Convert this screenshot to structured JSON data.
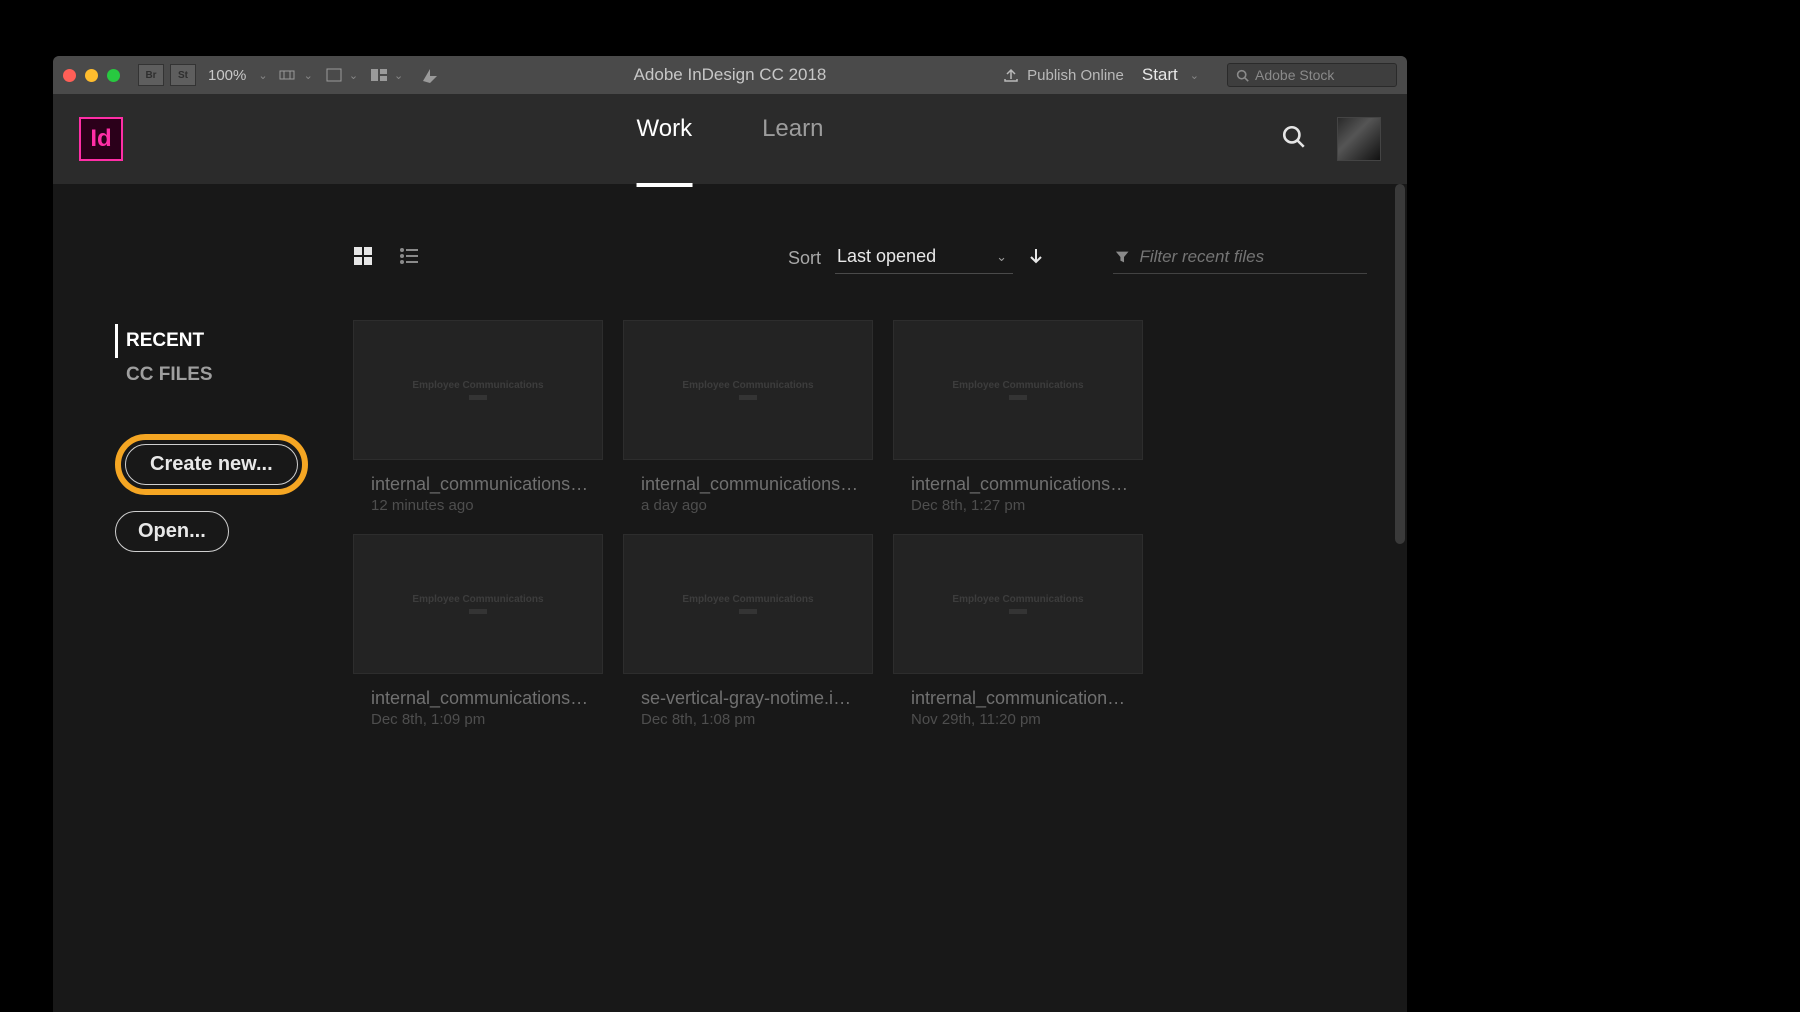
{
  "titlebar": {
    "tile_br": "Br",
    "tile_st": "St",
    "zoom": "100%",
    "app_title": "Adobe InDesign CC 2018",
    "publish": "Publish Online",
    "workspace": "Start",
    "stock_placeholder": "Adobe Stock"
  },
  "header": {
    "logo_text": "Id",
    "tabs": {
      "work": "Work",
      "learn": "Learn"
    }
  },
  "sidebar": {
    "recent": "RECENT",
    "ccfiles": "CC FILES",
    "create": "Create new...",
    "open": "Open..."
  },
  "toolbar": {
    "sort_label": "Sort",
    "sort_value": "Last opened",
    "filter_placeholder": "Filter recent files"
  },
  "thumb_label": "Employee Communications",
  "files": [
    {
      "name": "internal_communications…",
      "date": "12 minutes ago"
    },
    {
      "name": "internal_communications…",
      "date": "a day ago"
    },
    {
      "name": "internal_communications…",
      "date": "Dec 8th, 1:27 pm"
    },
    {
      "name": "internal_communications…",
      "date": "Dec 8th, 1:09 pm"
    },
    {
      "name": "se-vertical-gray-notime.indd",
      "date": "Dec 8th, 1:08 pm"
    },
    {
      "name": "intrernal_communications…",
      "date": "Nov 29th, 11:20 pm"
    }
  ]
}
